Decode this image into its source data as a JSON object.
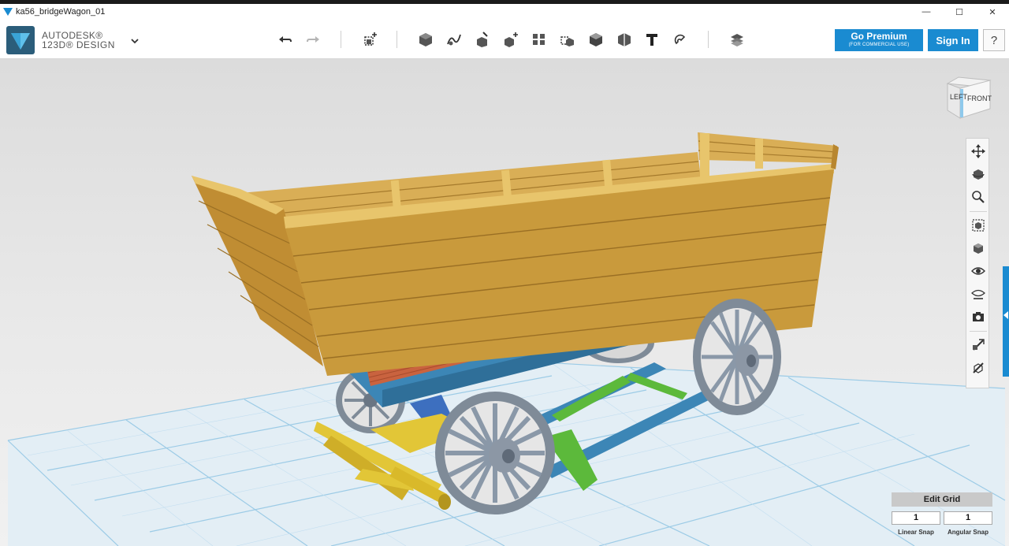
{
  "window": {
    "title": "ka56_bridgeWagon_01",
    "controls": {
      "minimize": "—",
      "maximize": "☐",
      "close": "✕"
    }
  },
  "brand": {
    "line1": "AUTODESK®",
    "line2": "123D® DESIGN"
  },
  "toolbar": {
    "tools": [
      "undo-icon",
      "redo-icon",
      "primitives-icon",
      "sketch-icon",
      "construct-icon",
      "modify-icon",
      "pattern-icon",
      "grouping-icon",
      "snap-icon",
      "combine-icon",
      "measure-icon",
      "text-icon",
      "material-icon",
      "layers-icon"
    ]
  },
  "premium": {
    "label": "Go Premium",
    "sublabel": "(FOR COMMERCIAL USE)"
  },
  "signin": {
    "label": "Sign In"
  },
  "help": {
    "label": "?"
  },
  "viewcube": {
    "left": "LEFT",
    "front": "FRONT"
  },
  "navbar": {
    "buttons": [
      "pan-icon",
      "orbit-icon",
      "zoom-icon",
      "fit-icon",
      "perspective-icon",
      "visibility-icon",
      "materials-visibility-icon",
      "camera-icon",
      "grid-snap-icon",
      "outline-icon"
    ]
  },
  "grid": {
    "header": "Edit Grid",
    "linear_snap": {
      "value": "1",
      "label": "Linear Snap"
    },
    "angular_snap": {
      "value": "1",
      "label": "Angular Snap"
    }
  },
  "colors": {
    "accent": "#1a8bd1",
    "wood": "#c99a3c",
    "frame_blue": "#3c86b6",
    "brace_green": "#5cb93b",
    "axle_yellow": "#e2c637",
    "deck_red": "#c9633f",
    "wheel_grey": "#8a98a8"
  }
}
